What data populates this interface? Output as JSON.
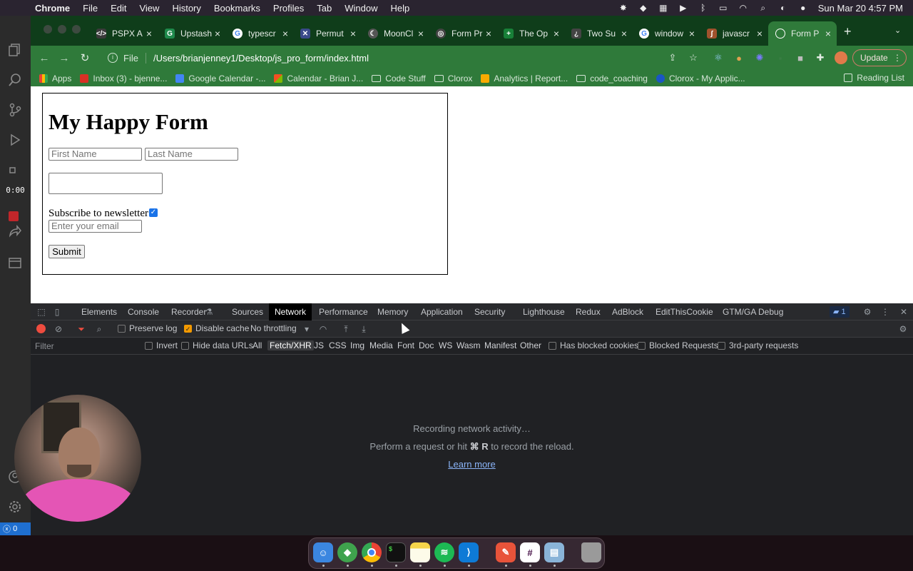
{
  "menubar": {
    "items": [
      "Chrome",
      "File",
      "Edit",
      "View",
      "History",
      "Bookmarks",
      "Profiles",
      "Tab",
      "Window",
      "Help"
    ],
    "datetime": "Sun Mar 20  4:57 PM"
  },
  "recorder": {
    "timer": "0:00",
    "status_count": "0"
  },
  "tabs": [
    {
      "label": "PSPX A",
      "icon": "code-icon",
      "color": "#3a3a3a"
    },
    {
      "label": "Upstash",
      "icon": "upstash-icon",
      "color": "#1f8a4c"
    },
    {
      "label": "typescr",
      "icon": "google-icon",
      "color": "#ffffff"
    },
    {
      "label": "Permut",
      "icon": "leetcode-icon",
      "color": "#3a4a8a"
    },
    {
      "label": "MoonCl",
      "icon": "moon-icon",
      "color": "#555555"
    },
    {
      "label": "Form Pr",
      "icon": "form-icon",
      "color": "#444444"
    },
    {
      "label": "The Op",
      "icon": "sheets-icon",
      "color": "#188038"
    },
    {
      "label": "Two Su",
      "icon": "hackerrank-icon",
      "color": "#444444"
    },
    {
      "label": "window",
      "icon": "google-icon",
      "color": "#ffffff"
    },
    {
      "label": "javascr",
      "icon": "javascript-icon",
      "color": "#a0522d"
    },
    {
      "label": "Form Pr",
      "icon": "globe-icon",
      "color": "#2f7a3a"
    }
  ],
  "address": {
    "scheme": "File",
    "url": "/Users/brianjenney1/Desktop/js_pro_form/index.html"
  },
  "update_label": "Update",
  "bookmarks": [
    {
      "label": "Apps",
      "type": "apps"
    },
    {
      "label": "Inbox (3) - bjenne...",
      "type": "gmail"
    },
    {
      "label": "Google Calendar -...",
      "type": "calendar"
    },
    {
      "label": "Calendar - Brian J...",
      "type": "ms"
    },
    {
      "label": "Code Stuff",
      "type": "folder"
    },
    {
      "label": "Clorox",
      "type": "folder"
    },
    {
      "label": "Analytics | Report...",
      "type": "analytics"
    },
    {
      "label": "code_coaching",
      "type": "folder"
    },
    {
      "label": "Clorox - My Applic...",
      "type": "app"
    }
  ],
  "reading_list": "Reading List",
  "form": {
    "title": "My Happy Form",
    "first_name_placeholder": "First Name",
    "last_name_placeholder": "Last Name",
    "subscribe_label": "Subscribe to newsletter",
    "subscribe_checked": true,
    "email_placeholder": "Enter your email",
    "submit_label": "Submit"
  },
  "devtools": {
    "tabs": [
      "Elements",
      "Console",
      "Recorder",
      "Sources",
      "Network",
      "Performance",
      "Memory",
      "Application",
      "Security",
      "Lighthouse",
      "Redux",
      "AdBlock",
      "EditThisCookie",
      "GTM/GA Debug"
    ],
    "active_tab": "Network",
    "issues_count": "1",
    "preserve_log": "Preserve log",
    "disable_cache": "Disable cache",
    "throttling": "No throttling",
    "filter_placeholder": "Filter",
    "invert": "Invert",
    "hide_data_urls": "Hide data URLs",
    "types": [
      "All",
      "Fetch/XHR",
      "JS",
      "CSS",
      "Img",
      "Media",
      "Font",
      "Doc",
      "WS",
      "Wasm",
      "Manifest",
      "Other"
    ],
    "active_type": "Fetch/XHR",
    "has_blocked_cookies": "Has blocked cookies",
    "blocked_requests": "Blocked Requests",
    "third_party": "3rd-party requests",
    "empty_line1": "Recording network activity…",
    "empty_line2_prefix": "Perform a request or hit ",
    "empty_line2_keys": "⌘ R",
    "empty_line2_suffix": " to record the reload.",
    "learn_more": "Learn more"
  },
  "dock": [
    "Finder",
    "SourceTree",
    "Chrome",
    "Terminal",
    "Notes",
    "Spotify",
    "VS Code",
    "Scrivener",
    "Slack",
    "Preview",
    "Trash"
  ]
}
